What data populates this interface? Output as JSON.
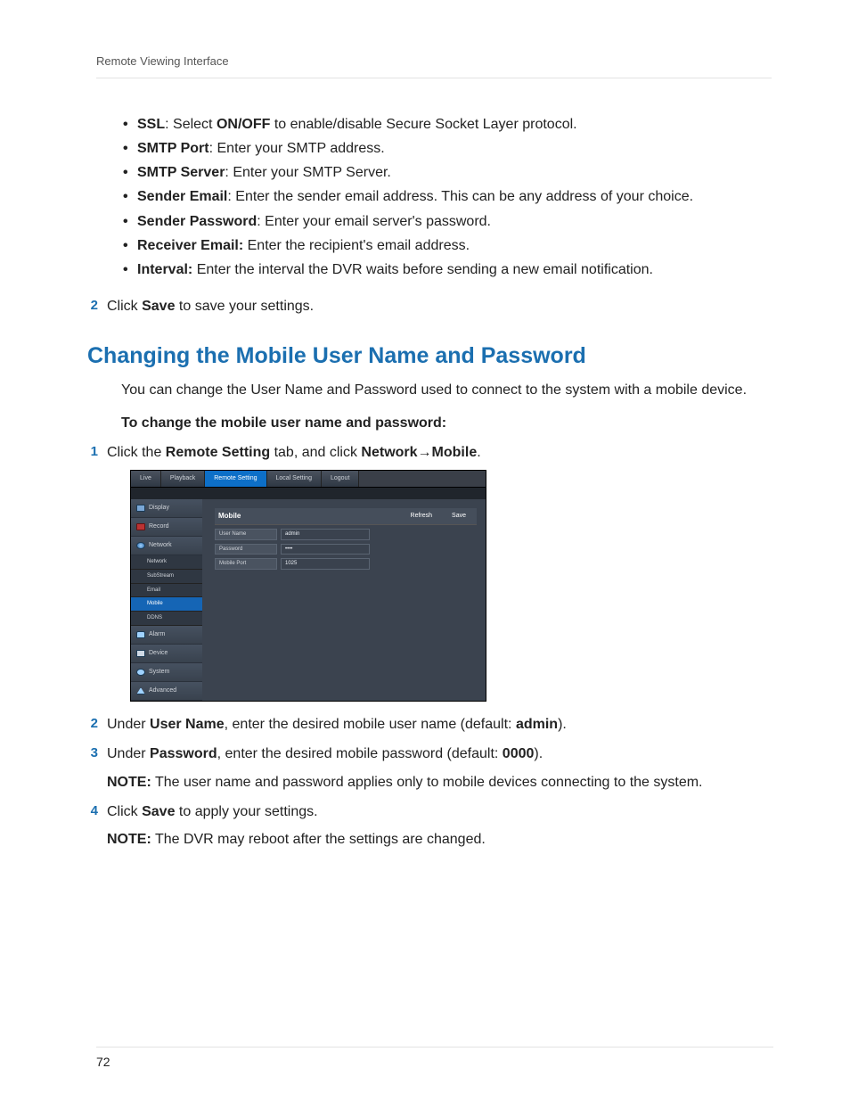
{
  "header": "Remote Viewing Interface",
  "pageNumber": "72",
  "bullets": [
    {
      "term": "SSL",
      "body": ": Select ",
      "mid": "ON/OFF",
      "tail": " to enable/disable Secure Socket Layer protocol."
    },
    {
      "term": "SMTP Port",
      "body": ": Enter your SMTP address."
    },
    {
      "term": "SMTP Server",
      "body": ": Enter your SMTP Server."
    },
    {
      "term": "Sender Email",
      "body": ": Enter the sender email address. This can be any address of your choice."
    },
    {
      "term": "Sender Password",
      "body": ": Enter your email server's password."
    },
    {
      "term": "Receiver Email:",
      "body": " Enter the recipient's email address."
    },
    {
      "term": "Interval:",
      "body": " Enter the interval the DVR waits before sending a new email notification."
    }
  ],
  "stepA": {
    "num": "2",
    "pre": "Click ",
    "bold": "Save",
    "post": " to save your settings."
  },
  "sectionTitle": "Changing the Mobile User Name and Password",
  "sectionIntro": "You can change the User Name and Password used to connect to the system with a mobile device.",
  "subheading": "To change the mobile user name and password:",
  "step1": {
    "num": "1",
    "pre": "Click the ",
    "b1": "Remote Setting",
    "mid": " tab, and click ",
    "b2": "Network",
    "arrow": "→",
    "b3": "Mobile",
    "post": "."
  },
  "shot": {
    "tabs": [
      "Live",
      "Playback",
      "Remote Setting",
      "Local Setting",
      "Logout"
    ],
    "activeTab": 2,
    "side": [
      {
        "label": "Display",
        "kind": "item"
      },
      {
        "label": "Record",
        "kind": "item",
        "icon": "red"
      },
      {
        "label": "Network",
        "kind": "item",
        "icon": "globe",
        "expanded": true
      },
      {
        "label": "Network",
        "kind": "sub"
      },
      {
        "label": "SubStream",
        "kind": "sub"
      },
      {
        "label": "Email",
        "kind": "sub"
      },
      {
        "label": "Mobile",
        "kind": "sub",
        "sel": true
      },
      {
        "label": "DDNS",
        "kind": "sub"
      },
      {
        "label": "Alarm",
        "kind": "item",
        "icon": "bell"
      },
      {
        "label": "Device",
        "kind": "item",
        "icon": "dev"
      },
      {
        "label": "System",
        "kind": "item",
        "icon": "gear"
      },
      {
        "label": "Advanced",
        "kind": "item",
        "icon": "adv"
      }
    ],
    "panelTitle": "Mobile",
    "panelButtons": [
      "Refresh",
      "Save"
    ],
    "rows": [
      {
        "label": "User Name",
        "value": "admin"
      },
      {
        "label": "Password",
        "value": "••••"
      },
      {
        "label": "Mobile Port",
        "value": "1025"
      }
    ]
  },
  "step2": {
    "num": "2",
    "pre": "Under ",
    "b1": "User Name",
    "mid": ", enter the desired mobile user name (default: ",
    "b2": "admin",
    "post": ")."
  },
  "step3": {
    "num": "3",
    "pre": "Under ",
    "b1": "Password",
    "mid": ", enter the desired mobile password (default: ",
    "b2": "0000",
    "post": ")."
  },
  "note3": {
    "label": "NOTE:",
    "body": " The user name and password applies only to mobile devices connecting to the system."
  },
  "step4": {
    "num": "4",
    "pre": "Click ",
    "b1": "Save",
    "post": " to apply your settings."
  },
  "note4": {
    "label": "NOTE:",
    "body": " The DVR may reboot after the settings are changed."
  }
}
